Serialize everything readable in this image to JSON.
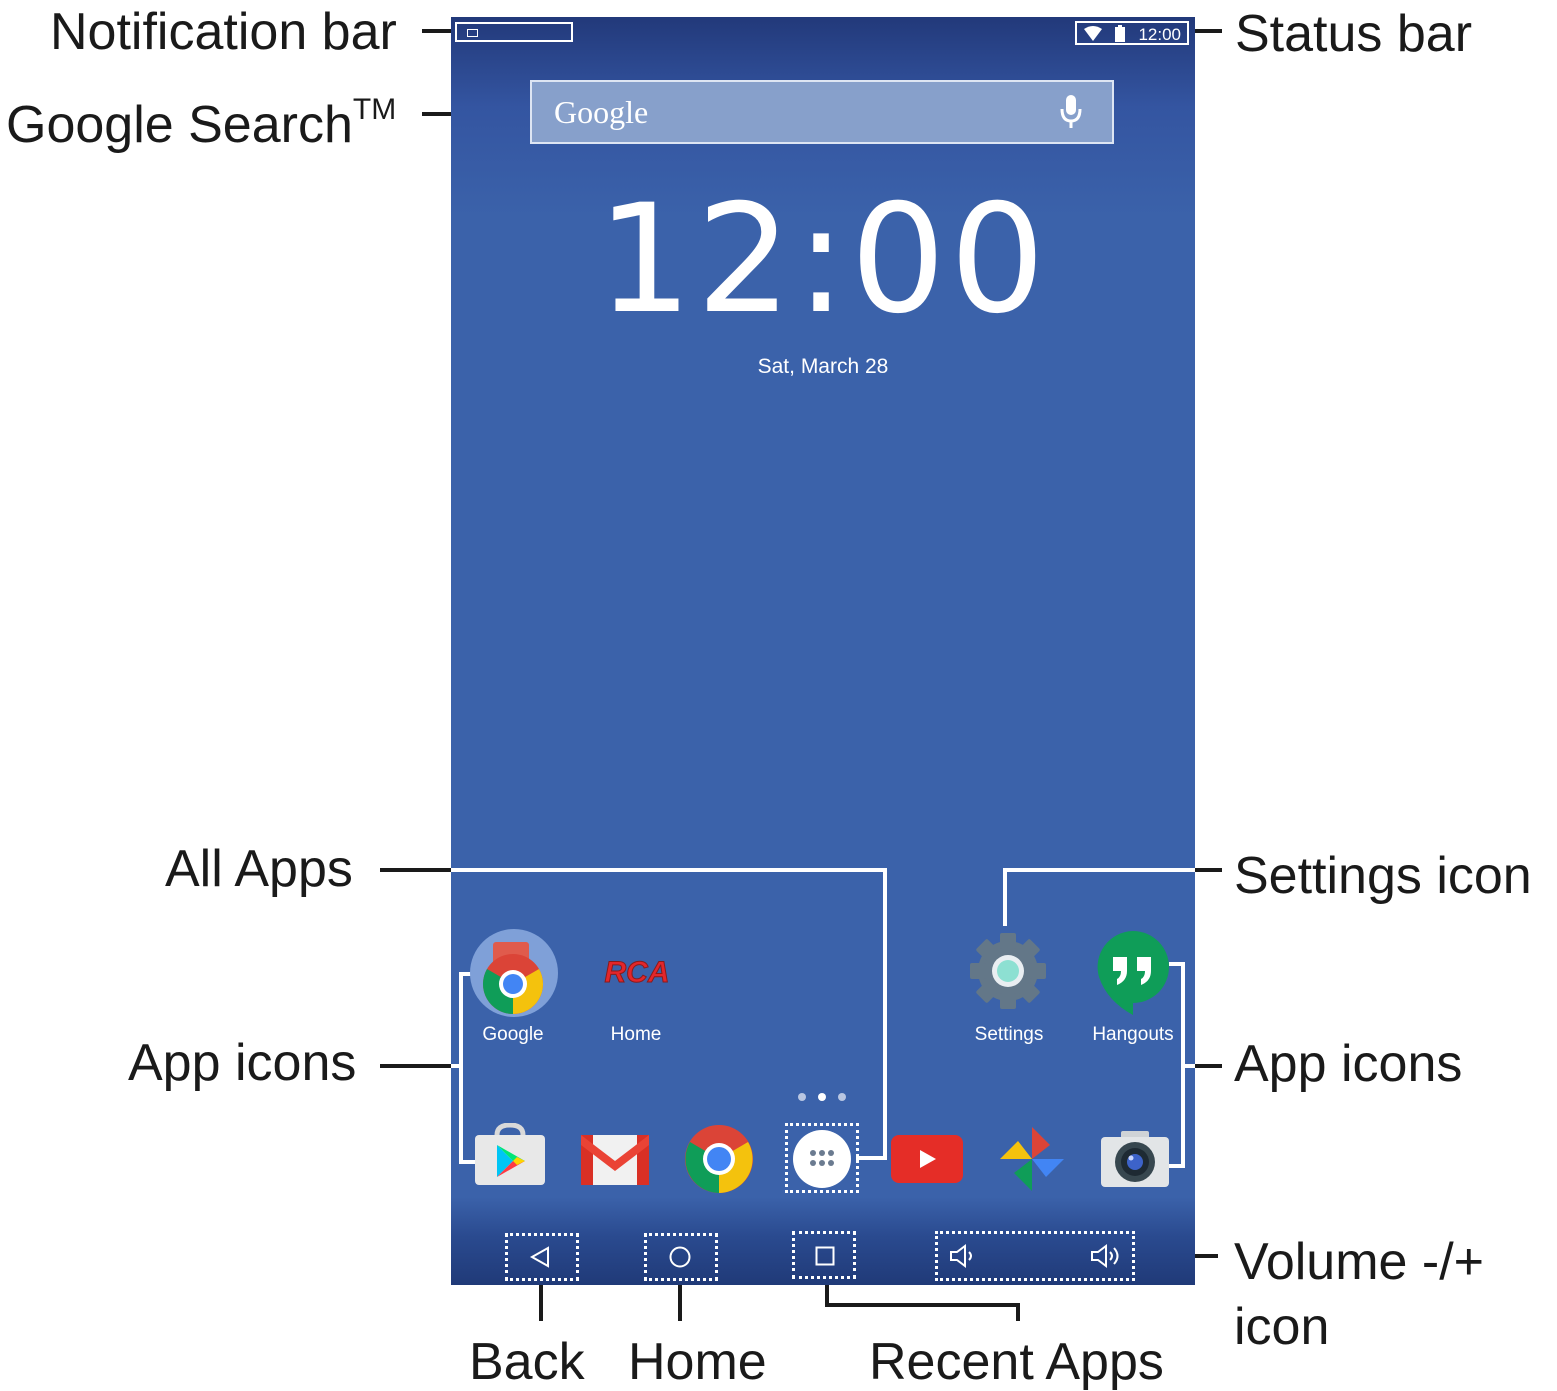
{
  "callouts": {
    "notification_bar": "Notification bar",
    "google_search": "Google Search",
    "google_search_tm": "TM",
    "status_bar": "Status bar",
    "all_apps": "All Apps",
    "settings_icon": "Settings icon",
    "app_icons_left": "App icons",
    "app_icons_right": "App icons",
    "volume_line1": "Volume -/+",
    "volume_line2": "icon",
    "back": "Back",
    "home": "Home",
    "recent_apps": "Recent Apps"
  },
  "screen": {
    "status_time": "12:00",
    "search_logo": "Google",
    "clock": "12:00",
    "date": "Sat, March 28",
    "apps_row1": [
      {
        "label": "Google",
        "icon": "google-folder-icon"
      },
      {
        "label": "Home",
        "icon": "rca-home-icon",
        "logo_text": "RCA"
      },
      {
        "label": "Settings",
        "icon": "settings-gear-icon"
      },
      {
        "label": "Hangouts",
        "icon": "hangouts-icon"
      }
    ],
    "dock": [
      "play-store-icon",
      "gmail-icon",
      "chrome-icon",
      "all-apps-icon",
      "youtube-icon",
      "photos-icon",
      "camera-icon"
    ],
    "nav": [
      "back-icon",
      "home-icon",
      "recent-apps-icon",
      "volume-down-icon",
      "volume-up-icon"
    ]
  },
  "colors": {
    "screen_blue": "#3b62aa",
    "search_bar": "#87a0cb"
  }
}
